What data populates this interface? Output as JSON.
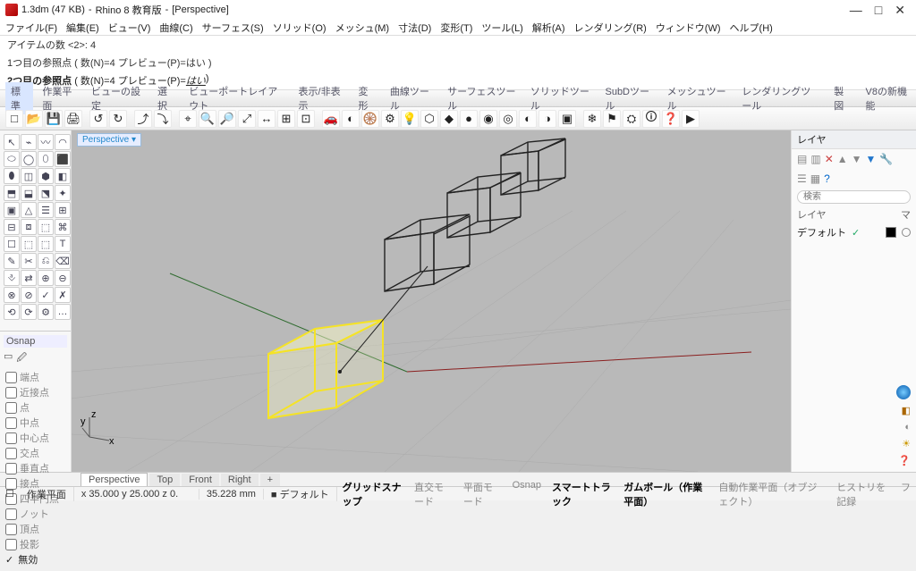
{
  "titlebar": {
    "filename": "1.3dm (47 KB)",
    "app": "Rhino 8 教育版",
    "view": "[Perspective]"
  },
  "window_controls": {
    "min": "—",
    "max": "□",
    "close": "✕"
  },
  "menubar": [
    "ファイル(F)",
    "編集(E)",
    "ビュー(V)",
    "曲線(C)",
    "サーフェス(S)",
    "ソリッド(O)",
    "メッシュ(M)",
    "寸法(D)",
    "変形(T)",
    "ツール(L)",
    "解析(A)",
    "レンダリング(R)",
    "ウィンドウ(W)",
    "ヘルプ(H)"
  ],
  "command_history": [
    "アイテムの数 <2>: 4",
    "1つ目の参照点 ( 数(N)=4  プレビュー(P)=はい )"
  ],
  "command_prompt": {
    "label": "2つ目の参照点",
    "rest": "( 数(N)=4  プレビュー(P)=",
    "value": "はい",
    "tail": ")"
  },
  "tabs": [
    "標準",
    "作業平面",
    "ビューの設定",
    "選択",
    "ビューポートレイアウト",
    "表示/非表示",
    "変形",
    "曲線ツール",
    "サーフェスツール",
    "ソリッドツール",
    "SubDツール",
    "メッシュツール",
    "レンダリングツール",
    "製図",
    "V8の新機能"
  ],
  "active_tab": 0,
  "toolbar_icons": [
    "□",
    "📂",
    "💾",
    "🖨",
    "",
    "↺",
    "↻",
    "",
    "⤴",
    "⤵",
    "",
    "⌖",
    "🔍",
    "🔎",
    "⤢",
    "↔",
    "⊞",
    "⊡",
    "",
    "🚗",
    "◐",
    "🛞",
    "⚙",
    "💡",
    "⬡",
    "◆",
    "●",
    "◉",
    "◎",
    "◐",
    "◑",
    "▣",
    "",
    "❄",
    "⚑",
    "⛭",
    "🛈",
    "❓",
    "▶"
  ],
  "left_tools_count": 44,
  "left_tool_glyphs": [
    "↖",
    "⌁",
    "〰",
    "◠",
    "⬭",
    "◯",
    "⬯",
    "⬛",
    "⬮",
    "◫",
    "⬢",
    "◧",
    "⬒",
    "⬓",
    "⬔",
    "✦",
    "▣",
    "△",
    "☰",
    "⊞",
    "⊟",
    "⧈",
    "⬚",
    "⌘",
    "☐",
    "⬚",
    "⬚",
    "T",
    "✎",
    "✂",
    "⎌",
    "⌫",
    "⎀",
    "⇄",
    "⊕",
    "⊖",
    "⊗",
    "⊘",
    "✓",
    "✗",
    "⟲",
    "⟳",
    "⚙",
    "…"
  ],
  "osnap": {
    "title": "Osnap",
    "items": [
      "端点",
      "近接点",
      "点",
      "中点",
      "中心点",
      "交点",
      "垂直点",
      "接点",
      "四半円点",
      "ノット",
      "頂点",
      "投影"
    ],
    "last": "無効"
  },
  "viewport_label": "Perspective ▾",
  "viewport_tabs": [
    "Perspective",
    "Top",
    "Front",
    "Right",
    "+"
  ],
  "right_panel": {
    "title": "レイヤ",
    "search_placeholder": "検索",
    "header_left": "レイヤ",
    "header_right": "マ",
    "row_name": "デフォルト"
  },
  "status": {
    "left1": "作業平面",
    "coords": "x 35.000   y 25.000   z 0.",
    "dist": "35.228 mm",
    "layer": "デフォルト",
    "toggles": [
      {
        "label": "グリッドスナップ",
        "on": true
      },
      {
        "label": "直交モード",
        "on": false
      },
      {
        "label": "平面モード",
        "on": false
      },
      {
        "label": "Osnap",
        "on": false
      },
      {
        "label": "スマートトラック",
        "on": true
      },
      {
        "label": "ガムボール（作業平面）",
        "on": true
      },
      {
        "label": "自動作業平面（オブジェクト）",
        "on": false
      },
      {
        "label": "ヒストリを記録",
        "on": false
      },
      {
        "label": "フ",
        "on": false
      }
    ]
  },
  "axis_labels": {
    "x": "x",
    "y": "y",
    "z": "z"
  }
}
